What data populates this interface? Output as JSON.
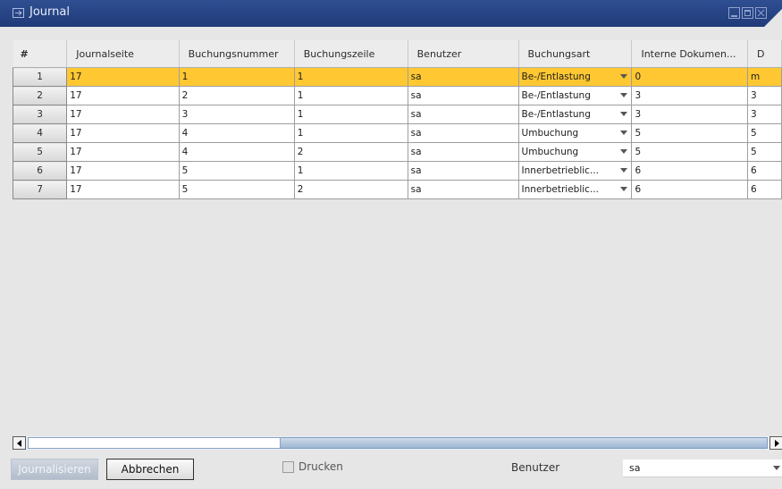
{
  "window": {
    "title": "Journal",
    "icon": "journal-icon",
    "controls": [
      "minimize-icon",
      "maximize-icon",
      "close-icon"
    ],
    "titlebar_color": "#2a4a8e",
    "selected_row_color": "#ffc832"
  },
  "grid": {
    "columns": [
      "#",
      "Journalseite",
      "Buchungsnummer",
      "Buchungszeile",
      "Benutzer",
      "Buchungsart",
      "Interne Dokumen...",
      "D"
    ],
    "rows": [
      {
        "num": "1",
        "cells": [
          "17",
          "1",
          "1",
          "sa",
          "Be-/Entlastung",
          "0",
          "m"
        ]
      },
      {
        "num": "2",
        "cells": [
          "17",
          "2",
          "1",
          "sa",
          "Be-/Entlastung",
          "3",
          "3"
        ]
      },
      {
        "num": "3",
        "cells": [
          "17",
          "3",
          "1",
          "sa",
          "Be-/Entlastung",
          "3",
          "3"
        ]
      },
      {
        "num": "4",
        "cells": [
          "17",
          "4",
          "1",
          "sa",
          "Umbuchung",
          "5",
          "5"
        ]
      },
      {
        "num": "5",
        "cells": [
          "17",
          "4",
          "2",
          "sa",
          "Umbuchung",
          "5",
          "5"
        ]
      },
      {
        "num": "6",
        "cells": [
          "17",
          "5",
          "1",
          "sa",
          "Innerbetrieblic...",
          "6",
          "6"
        ]
      },
      {
        "num": "7",
        "cells": [
          "17",
          "5",
          "2",
          "sa",
          "Innerbetrieblic...",
          "6",
          "6"
        ]
      }
    ]
  },
  "footer": {
    "journalize_label": "Journalisieren",
    "cancel_label": "Abbrechen",
    "print_label": "Drucken",
    "user_label": "Benutzer",
    "user_value": "sa"
  }
}
